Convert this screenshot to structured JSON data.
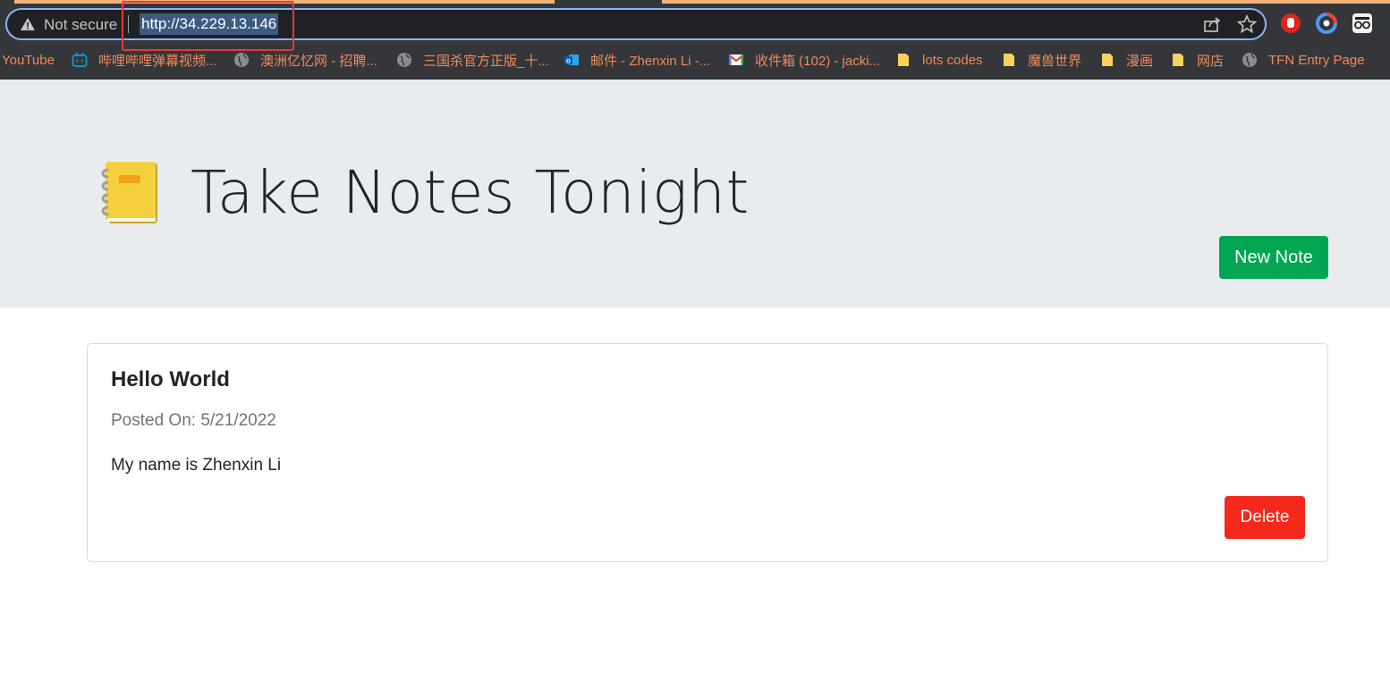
{
  "browser": {
    "security_label": "Not secure",
    "url": "http://34.229.13.146",
    "bookmarks": [
      {
        "label": "YouTube",
        "icon": "youtube-icon"
      },
      {
        "label": "哔哩哔哩弹幕视频...",
        "icon": "bilibili-icon"
      },
      {
        "label": "澳洲亿忆网 - 招聘...",
        "icon": "globe-icon"
      },
      {
        "label": "三国杀官方正版_十...",
        "icon": "globe-icon"
      },
      {
        "label": "邮件 - Zhenxin Li -...",
        "icon": "outlook-icon"
      },
      {
        "label": "收件箱 (102) - jacki...",
        "icon": "gmail-icon"
      },
      {
        "label": "lots codes",
        "icon": "folder-icon"
      },
      {
        "label": "魔兽世界",
        "icon": "folder-icon"
      },
      {
        "label": "漫画",
        "icon": "folder-icon"
      },
      {
        "label": "网店",
        "icon": "folder-icon"
      },
      {
        "label": "TFN Entry Page",
        "icon": "globe-icon"
      }
    ],
    "colors": {
      "highlight": "#e53935",
      "bookmark_text": "#f08a5d"
    }
  },
  "header": {
    "title": "Take Notes Tonight",
    "icon": "notebook-icon",
    "new_note_label": "New Note"
  },
  "notes": [
    {
      "title": "Hello World",
      "posted": "Posted On: 5/21/2022",
      "body": "My name is Zhenxin Li",
      "delete_label": "Delete"
    }
  ],
  "colors": {
    "new_note_button": "#00a651",
    "delete_button": "#f5291b",
    "jumbotron": "#e9ecef"
  }
}
